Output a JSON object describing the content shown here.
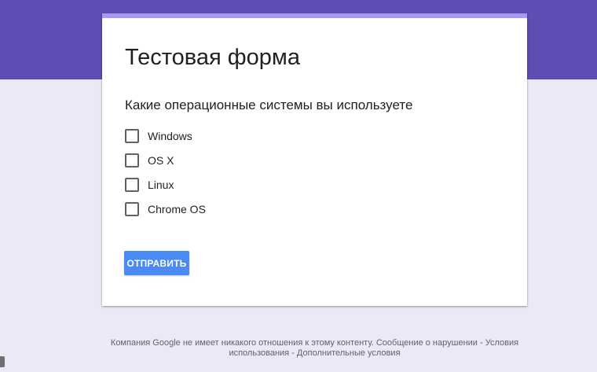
{
  "form": {
    "title": "Тестовая форма",
    "question": "Какие операционные системы вы используете",
    "options": [
      {
        "label": "Windows",
        "checked": false
      },
      {
        "label": "OS X",
        "checked": false
      },
      {
        "label": "Linux",
        "checked": false
      },
      {
        "label": "Chrome OS",
        "checked": false
      }
    ],
    "submit_label": "ОТПРАВИТЬ"
  },
  "footer": {
    "disclaimer": "Компания Google не имеет никакого отношения к этому контенту.",
    "report_link": "Сообщение о нарушении",
    "sep1": " - ",
    "terms_link": "Условия использования",
    "sep2": " - ",
    "additional_link": "Дополнительные условия"
  },
  "colors": {
    "header_band": "#5e4db3",
    "page_background": "#ece8f5",
    "card_accent": "#a698f3",
    "submit_button": "#4a8af4"
  }
}
